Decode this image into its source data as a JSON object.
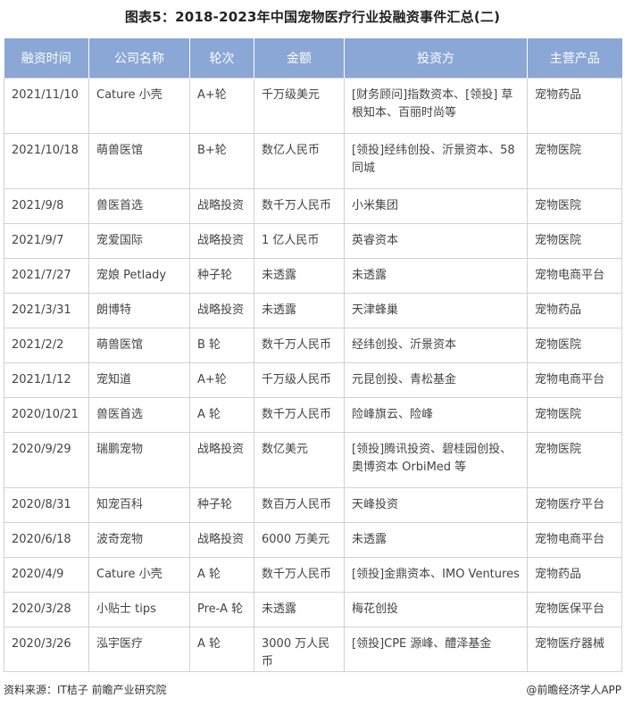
{
  "title": "图表5：2018-2023年中国宠物医疗行业投融资事件汇总(二)",
  "headers": [
    "融资时间",
    "公司名称",
    "轮次",
    "金额",
    "投资方",
    "主营产品"
  ],
  "rows": [
    [
      "2021/11/10",
      "Cature 小壳",
      "A+轮",
      "千万级美元",
      "[财务顾问]指数资本、[领投] 草根知本、百丽时尚等",
      "宠物药品"
    ],
    [
      "2021/10/18",
      "萌兽医馆",
      "B+轮",
      "数亿人民币",
      "[领投]经纬创投、沂景资本、58 同城",
      "宠物医院"
    ],
    [
      "2021/9/8",
      "兽医首选",
      "战略投资",
      "数千万人民币",
      "小米集团",
      "宠物医院"
    ],
    [
      "2021/9/7",
      "宠爱国际",
      "战略投资",
      "1 亿人民币",
      "英睿资本",
      "宠物医院"
    ],
    [
      "2021/7/27",
      "宠娘 Petlady",
      "种子轮",
      "未透露",
      "未透露",
      "宠物电商平台"
    ],
    [
      "2021/3/31",
      "朗博特",
      "战略投资",
      "未透露",
      "天津蜂巢",
      "宠物药品"
    ],
    [
      "2021/2/2",
      "萌兽医馆",
      "B 轮",
      "数千万人民币",
      "经纬创投、沂景资本",
      "宠物医院"
    ],
    [
      "2021/1/12",
      "宠知道",
      "A+轮",
      "千万级人民币",
      "元昆创投、青松基金",
      "宠物电商平台"
    ],
    [
      "2020/10/21",
      "兽医首选",
      "A 轮",
      "数千万人民币",
      "险峰旗云、险峰",
      "宠物医院"
    ],
    [
      "2020/9/29",
      "瑞鹏宠物",
      "战略投资",
      "数亿美元",
      "[领投]腾讯投资、碧桂园创投、奥博资本 OrbiMed 等",
      "宠物医院"
    ],
    [
      "2020/8/31",
      "知宠百科",
      "种子轮",
      "数百万人民币",
      "天峰投资",
      "宠物医疗平台"
    ],
    [
      "2020/6/18",
      "波奇宠物",
      "战略投资",
      "6000 万美元",
      "未透露",
      "宠物电商平台"
    ],
    [
      "2020/4/9",
      "Cature 小壳",
      "A 轮",
      "数千万人民币",
      "[领投]金鼎资本、IMO Ventures",
      "宠物药品"
    ],
    [
      "2020/3/28",
      "小贴士 tips",
      "Pre-A 轮",
      "未透露",
      "梅花创投",
      "宠物医保平台"
    ],
    [
      "2020/3/26",
      "泓宇医疗",
      "A 轮",
      "3000 万人民币",
      "[领投]CPE 源峰、醴泽基金",
      "宠物医疗器械"
    ]
  ],
  "footer": {
    "source": "资料来源：IT桔子 前瞻产业研究院",
    "brand": "@前瞻经济学人APP"
  },
  "colors": {
    "header_bg": "#8aa7d5",
    "grid": "#d2d2d2"
  }
}
